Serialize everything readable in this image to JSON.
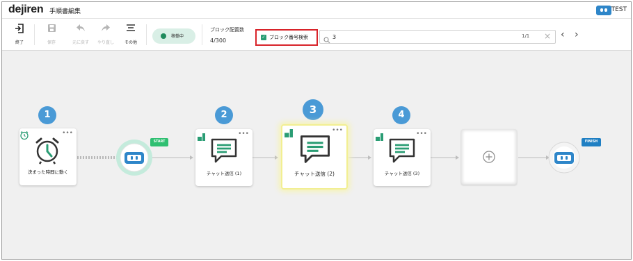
{
  "app": {
    "logo": "dejiren",
    "page_title": "手順書編集",
    "project_name": "TEST"
  },
  "toolbar": {
    "exit_label": "終了",
    "save_label": "保存",
    "undo_label": "元に戻す",
    "redo_label": "やり直し",
    "more_label": "その他",
    "status_label": "稼働中",
    "block_count_label": "ブロック配置数",
    "block_count_value": "4/300",
    "search_toggle_label": "ブロック番号検索",
    "search_value": "3",
    "search_result": "1/1"
  },
  "flow": {
    "start_tag": "START",
    "finish_tag": "FINISH",
    "blocks": [
      {
        "number": "1",
        "label": "決まった時間に動く"
      },
      {
        "number": "2",
        "label": "チャット送信 (1)"
      },
      {
        "number": "3",
        "label": "チャット送信 (2)"
      },
      {
        "number": "4",
        "label": "チャット送信 (3)"
      }
    ],
    "menu_glyph": "•••"
  },
  "colors": {
    "accent_blue": "#4a9ad6",
    "bot_blue": "#2e86c9",
    "status_green": "#1f8a5c",
    "chat_green": "#2a9d74",
    "search_border": "#d8232a"
  }
}
